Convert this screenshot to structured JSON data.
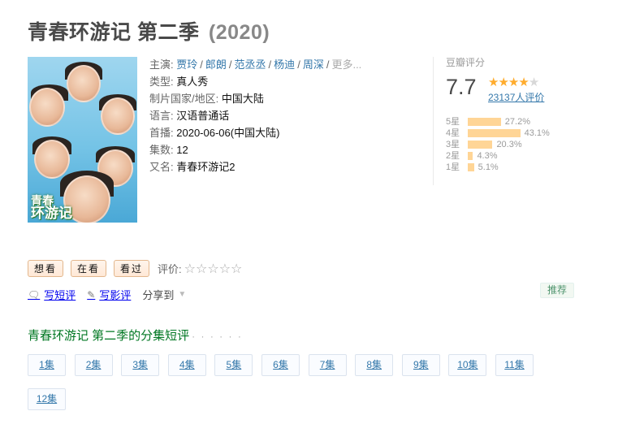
{
  "title": {
    "name": "青春环游记 第二季",
    "year": "(2020)"
  },
  "info": {
    "cast_label": "主演:",
    "cast": [
      "贾玲",
      "郎朗",
      "范丞丞",
      "杨迪",
      "周深"
    ],
    "cast_more": "更多...",
    "type_label": "类型:",
    "type": "真人秀",
    "region_label": "制片国家/地区:",
    "region": "中国大陆",
    "lang_label": "语言:",
    "lang": "汉语普通话",
    "premiere_label": "首播:",
    "premiere": "2020-06-06(中国大陆)",
    "episodes_label": "集数:",
    "episodes": "12",
    "alias_label": "又名:",
    "alias": "青春环游记2"
  },
  "poster": {
    "logo_top": "青春",
    "logo_bottom": "环游记"
  },
  "rating": {
    "label": "豆瓣评分",
    "score": "7.7",
    "stars_filled": 4,
    "votes": "23137人评价",
    "breakdown": [
      {
        "label": "5星",
        "pct": "27.2%",
        "value": 27.2
      },
      {
        "label": "4星",
        "pct": "43.1%",
        "value": 43.1
      },
      {
        "label": "3星",
        "pct": "20.3%",
        "value": 20.3
      },
      {
        "label": "2星",
        "pct": "4.3%",
        "value": 4.3
      },
      {
        "label": "1星",
        "pct": "5.1%",
        "value": 5.1
      }
    ]
  },
  "actions": {
    "want": "想看",
    "watching": "在看",
    "watched": "看过",
    "rate_label": "评价:",
    "rate_stars": "☆☆☆☆☆"
  },
  "links": {
    "short_review": "写短评",
    "review": "写影评",
    "share": "分享到"
  },
  "recommend": "推荐",
  "episode_section": {
    "title": "青春环游记 第二季的分集短评",
    "dots": "· · · · · ·"
  },
  "episodes": [
    "1集",
    "2集",
    "3集",
    "4集",
    "5集",
    "6集",
    "7集",
    "8集",
    "9集",
    "10集",
    "11集",
    "12集"
  ],
  "colors": {
    "link": "#3377aa",
    "accent_green": "#007722",
    "star": "#ffac2d",
    "bar": "#ffd596"
  },
  "icons": {
    "poster": "poster-image",
    "comment": "comment-icon",
    "pen": "pen-icon",
    "caret": "caret-down-icon"
  }
}
